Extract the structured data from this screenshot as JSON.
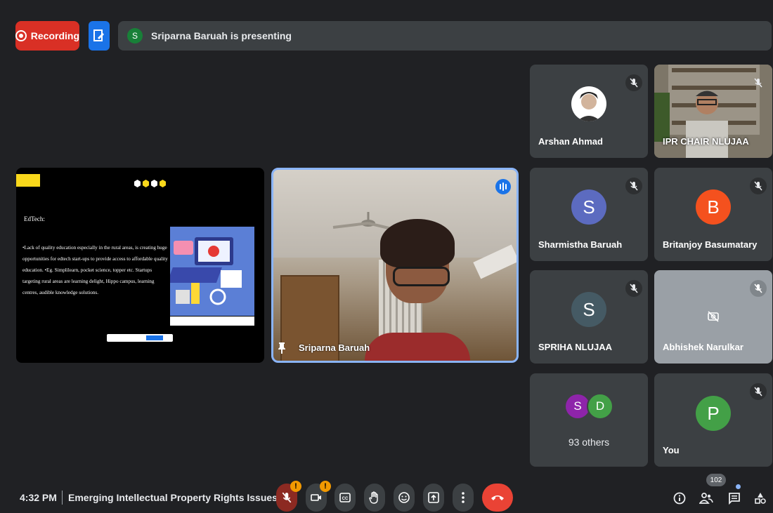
{
  "top_bar": {
    "recording_label": "Recording",
    "presenter_initial": "S",
    "presenting_text": "Sriparna Baruah is presenting",
    "colors": {
      "recording": "#d93025",
      "edit": "#1a73e8"
    }
  },
  "slide": {
    "title": "EdTech:",
    "body": "•Lack of quality education especially in the rural areas, is creating huge opportunities for edtech start-ups to provide access to affordable quality education. •Eg. Simplilearn, pocket science, topper etc. Startups targeting rural areas are learning delight, Hippo campus, learning centres, audible knowledge solutions."
  },
  "main_video": {
    "name": "Sriparna Baruah"
  },
  "participants": [
    {
      "name": "Arshan Ahmad",
      "type": "photo",
      "muted": true
    },
    {
      "name": "IPR CHAIR NLUJAA",
      "type": "video",
      "muted": true
    },
    {
      "name": "Sharmistha Baruah",
      "initial": "S",
      "color": "#5c6bc0",
      "muted": true
    },
    {
      "name": "Britanjoy Basumatary",
      "initial": "B",
      "color": "#f4511e",
      "muted": true
    },
    {
      "name": "SPRIHA NLUJAA",
      "initial": "S",
      "color": "#455a64",
      "muted": true
    },
    {
      "name": "Abhishek Narulkar",
      "type": "camera-off",
      "muted": true
    },
    {
      "name": "93 others",
      "initials": [
        "S",
        "D"
      ],
      "colors": [
        "#8e24aa",
        "#43a047"
      ]
    },
    {
      "name": "You",
      "initial": "P",
      "color": "#43a047",
      "muted": true
    }
  ],
  "bottom_bar": {
    "time": "4:32 PM",
    "meeting_title": "Emerging Intellectual Property Rights Issues",
    "alert_mark": "!",
    "participants_count": "102"
  }
}
